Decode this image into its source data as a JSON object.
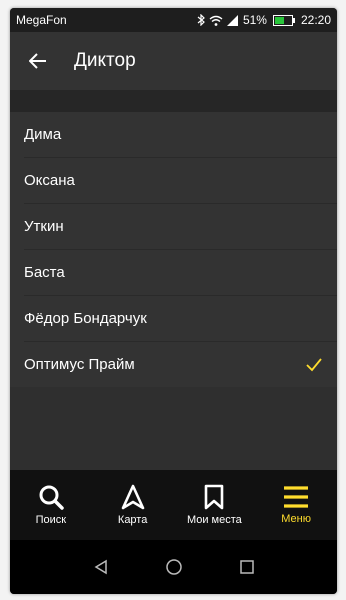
{
  "statusbar": {
    "carrier": "MegaFon",
    "battery": "51%",
    "time": "22:20",
    "icons": [
      "bluetooth-icon",
      "wifi-icon",
      "signal-icon",
      "battery-icon"
    ]
  },
  "header": {
    "title": "Диктор",
    "back_icon": "back-arrow-icon"
  },
  "voices": [
    {
      "label": "Дима",
      "selected": false
    },
    {
      "label": "Оксана",
      "selected": false
    },
    {
      "label": "Уткин",
      "selected": false
    },
    {
      "label": "Баста",
      "selected": false
    },
    {
      "label": "Фёдор Бондарчук",
      "selected": false
    },
    {
      "label": "Оптимус Прайм",
      "selected": true
    }
  ],
  "bottom_nav": [
    {
      "label": "Поиск",
      "icon": "search-icon",
      "active": false
    },
    {
      "label": "Карта",
      "icon": "navigation-arrow-icon",
      "active": false
    },
    {
      "label": "Мои места",
      "icon": "bookmark-icon",
      "active": false
    },
    {
      "label": "Меню",
      "icon": "menu-icon",
      "active": true
    }
  ],
  "colors": {
    "accent": "#ffdd2d",
    "background": "#333333",
    "nav_background": "#111111"
  }
}
